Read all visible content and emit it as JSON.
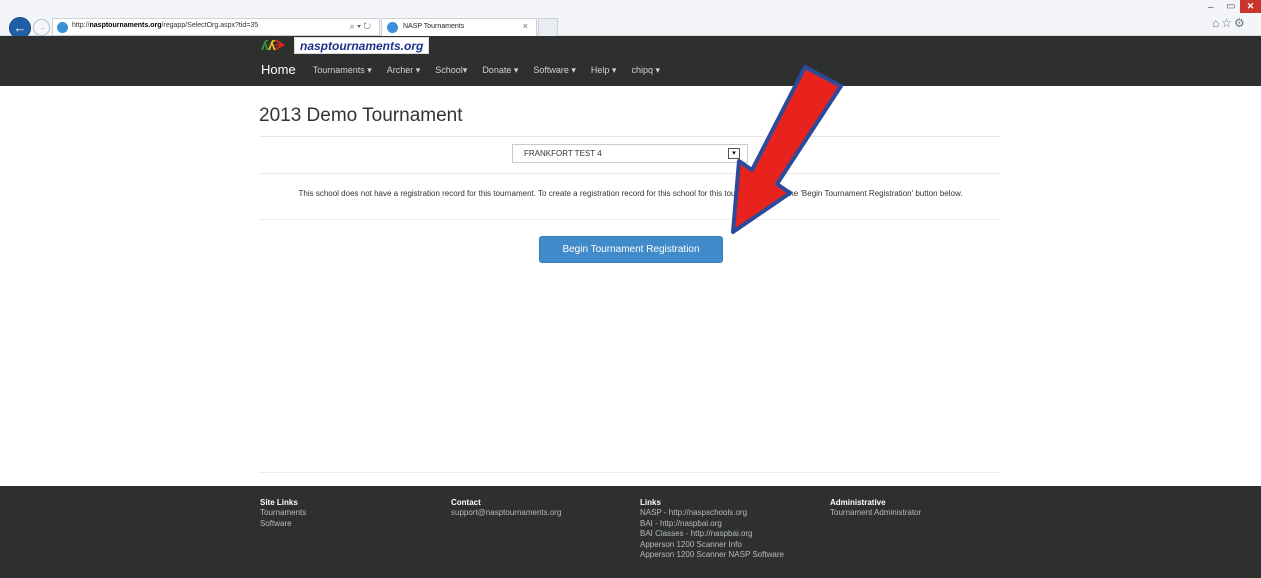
{
  "browser": {
    "url_prefix": "http://",
    "url_domain": "nasptournaments.org",
    "url_path": "/regapp/SelectOrg.aspx?tid=35",
    "address_icons": "⌕ ▾ ↻",
    "tab_title": "NASP Tournaments",
    "tab_close": "×",
    "back": "←",
    "forward": "→",
    "window_min": "–",
    "window_restore": "▭",
    "window_close": "✕",
    "tool_icons": "⌂☆⚙"
  },
  "site": {
    "logo_text": "nasptournaments.org",
    "nav": {
      "home": "Home",
      "items": [
        "Tournaments ▾",
        "Archer ▾",
        "School▾",
        "Donate ▾",
        "Software ▾",
        "Help ▾",
        "chipq ▾"
      ]
    }
  },
  "main": {
    "title": "2013 Demo Tournament",
    "school_select": {
      "value": "FRANKFORT TEST 4",
      "arrow": "▾"
    },
    "message": "This school does not have a registration record for this tournament. To create a registration record for this school for this tournament, click the 'Begin Tournament Registration' button below.",
    "button_label": "Begin Tournament Registration"
  },
  "footer": {
    "site_links": {
      "heading": "Site Links",
      "items": [
        "Tournaments",
        "Software"
      ]
    },
    "contact": {
      "heading": "Contact",
      "items": [
        "support@nasptournaments.org"
      ]
    },
    "links": {
      "heading": "Links",
      "items": [
        "NASP - http://naspschools.org",
        "BAI - http://naspbai.org",
        "BAI Classes - http://naspbai.org",
        "Apperson 1200 Scanner Info",
        "Apperson 1200 Scanner NASP Software"
      ]
    },
    "administrative": {
      "heading": "Administrative",
      "items": [
        "Tournament Administrator"
      ]
    }
  },
  "colors": {
    "nav_bg": "#2d302f",
    "button_bg": "#428bca",
    "arrow_red": "#e8231e",
    "arrow_outline": "#2b4a9a"
  }
}
